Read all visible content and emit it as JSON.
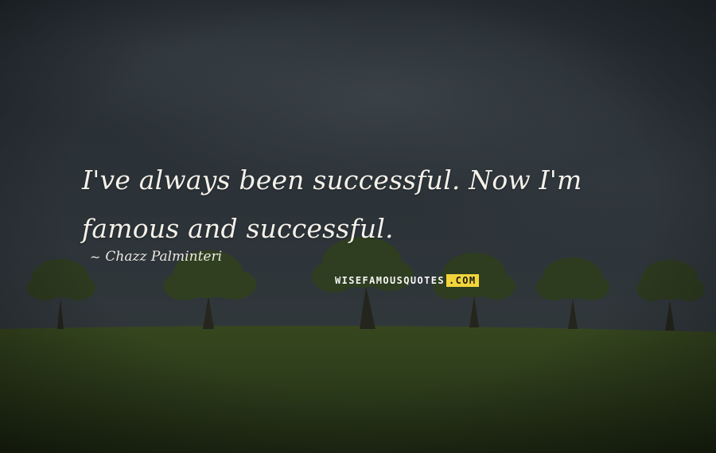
{
  "quote": {
    "text": "I've always been successful. Now I'm famous and successful."
  },
  "author": {
    "prefix": "~",
    "name": "Chazz Palminteri"
  },
  "watermark": {
    "main": "WISEFAMOUSQUOTES",
    "tld": ".COM"
  },
  "colors": {
    "sky": "#2a3136",
    "grass": "#2b3a1e",
    "text": "#f4f1ea",
    "watermark_accent": "#f2d43a"
  }
}
